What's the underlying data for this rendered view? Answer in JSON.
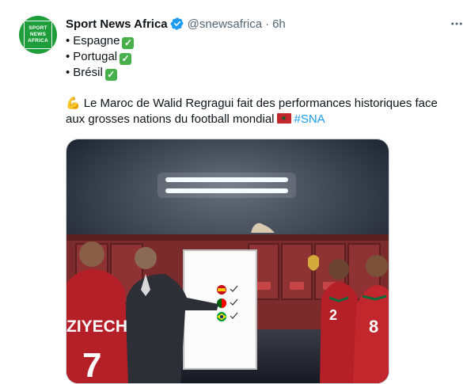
{
  "account": {
    "name": "Sport News Africa",
    "handle": "@snewsafrica",
    "separator": "·",
    "time": "6h",
    "avatar_text": [
      "SPORT",
      "NEWS",
      "AFRICA"
    ]
  },
  "tweet": {
    "list": [
      {
        "bullet": "•",
        "label": "Espagne"
      },
      {
        "bullet": "•",
        "label": "Portugal"
      },
      {
        "bullet": "•",
        "label": "Brésil"
      }
    ],
    "check_glyph": "✓",
    "body_line1": "Le Maroc de Walid Regragui fait des performances historiques face",
    "body_line2": "aux grosses nations du football mondial",
    "hashtag": "#SNA",
    "emoji": "💪"
  },
  "media": {
    "jersey_name": "ZIYECH",
    "jersey_number": "7",
    "player_numbers": [
      "2",
      "8"
    ]
  },
  "colors": {
    "brand_green": "#1d9e3a",
    "verified_blue": "#1d9bf0",
    "link": "#1d9bf0",
    "muted": "#536471",
    "morocco_red": "#c1272d"
  }
}
